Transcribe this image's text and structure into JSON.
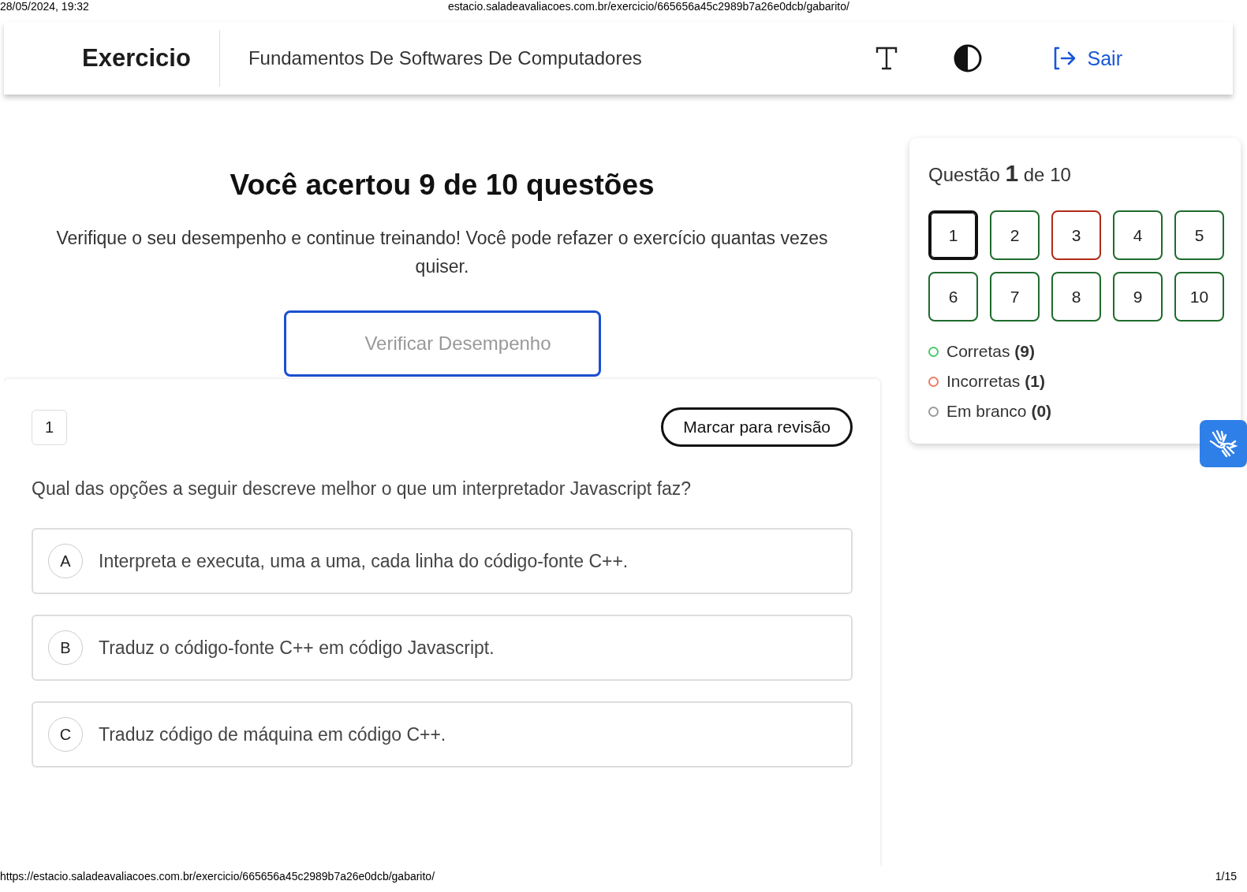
{
  "print_header": {
    "datetime": "28/05/2024, 19:32",
    "url": "estacio.saladeavaliacoes.com.br/exercicio/665656a45c2989b7a26e0dcb/gabarito/"
  },
  "top_bar": {
    "title": "Exercicio",
    "subject": "Fundamentos De Softwares De Computadores",
    "logout": "Sair"
  },
  "result": {
    "heading": "Você acertou 9 de 10 questões",
    "message": "Verifique o seu desempenho e continue treinando! Você pode refazer o exercício quantas vezes quiser.",
    "button": "Verificar Desempenho"
  },
  "question": {
    "number": "1",
    "review_button": "Marcar para revisão",
    "text": "Qual das opções a seguir descreve melhor o que um interpretador Javascript faz?",
    "options": [
      {
        "letter": "A",
        "text": "Interpreta e executa, uma a uma, cada linha do código-fonte C++."
      },
      {
        "letter": "B",
        "text": "Traduz o código-fonte C++ em código Javascript."
      },
      {
        "letter": "C",
        "text": "Traduz código de máquina em código C++."
      }
    ]
  },
  "navigator": {
    "title": "Questão **1** de 10",
    "questions": [
      {
        "label": "1",
        "kind": "current",
        "selected": true
      },
      {
        "label": "2",
        "kind": "correct",
        "selected": false
      },
      {
        "label": "3",
        "kind": "incorrect",
        "selected": false
      },
      {
        "label": "4",
        "kind": "correct",
        "selected": false
      },
      {
        "label": "5",
        "kind": "correct",
        "selected": false
      },
      {
        "label": "6",
        "kind": "correct",
        "selected": false
      },
      {
        "label": "7",
        "kind": "correct",
        "selected": false
      },
      {
        "label": "8",
        "kind": "correct",
        "selected": false
      },
      {
        "label": "9",
        "kind": "correct",
        "selected": false
      },
      {
        "label": "10",
        "kind": "correct",
        "selected": false
      }
    ],
    "legend": [
      {
        "label": "Corretas **(9)**",
        "color": "#4cc96b"
      },
      {
        "label": "Incorretas **(1)**",
        "color": "#f07a62"
      },
      {
        "label": "Em branco **(0)**",
        "color": "#9a9a9a"
      }
    ]
  },
  "print_footer": {
    "url": "https://estacio.saladeavaliacoes.com.br/exercicio/665656a45c2989b7a26e0dcb/gabarito/",
    "page": "1/15"
  }
}
